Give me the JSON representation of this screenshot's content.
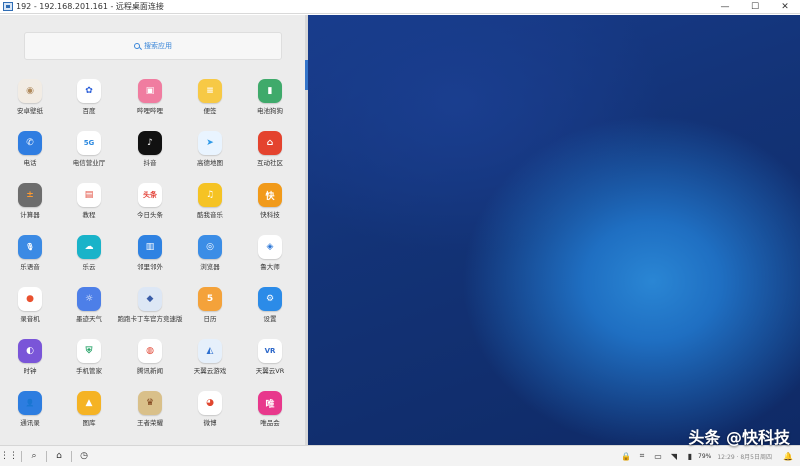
{
  "window": {
    "title": "192 - 192.168.201.161 - 远程桌面连接",
    "minimize": "—",
    "maximize": "☐",
    "close": "✕"
  },
  "search": {
    "placeholder": "搜索应用"
  },
  "apps": [
    {
      "label": "安卓壁纸",
      "glyph": "◉",
      "bg": "#f2ece4",
      "fg": "#b08a5c"
    },
    {
      "label": "百度",
      "glyph": "✿",
      "bg": "#ffffff",
      "fg": "#2b5fd9"
    },
    {
      "label": "哔哩哔哩",
      "glyph": "▣",
      "bg": "#f07ca0",
      "fg": "#ffffff"
    },
    {
      "label": "便签",
      "glyph": "≡",
      "bg": "#f7c945",
      "fg": "#ffffff"
    },
    {
      "label": "电池狗狗",
      "glyph": "▮",
      "bg": "#3faa6b",
      "fg": "#ffffff"
    },
    {
      "label": "电话",
      "glyph": "✆",
      "bg": "#2f7de1",
      "fg": "#ffffff"
    },
    {
      "label": "电信营业厅",
      "glyph": "5G",
      "bg": "#ffffff",
      "fg": "#2d8ae0"
    },
    {
      "label": "抖音",
      "glyph": "♪",
      "bg": "#111111",
      "fg": "#ffffff"
    },
    {
      "label": "高德地图",
      "glyph": "➤",
      "bg": "#e9f4ff",
      "fg": "#2f9ae8"
    },
    {
      "label": "互动社区",
      "glyph": "⌂",
      "bg": "#e4432e",
      "fg": "#ffffff"
    },
    {
      "label": "计算器",
      "glyph": "±",
      "bg": "#6d6d6d",
      "fg": "#ff9a2e"
    },
    {
      "label": "教程",
      "glyph": "▤",
      "bg": "#ffffff",
      "fg": "#e24a3b"
    },
    {
      "label": "今日头条",
      "glyph": "头条",
      "bg": "#ffffff",
      "fg": "#e23c32"
    },
    {
      "label": "酷我音乐",
      "glyph": "♫",
      "bg": "#f5c324",
      "fg": "#ffffff"
    },
    {
      "label": "快科技",
      "glyph": "快",
      "bg": "#f19a1a",
      "fg": "#ffffff"
    },
    {
      "label": "乐语音",
      "glyph": "🎙",
      "bg": "#3b8ae4",
      "fg": "#ffffff"
    },
    {
      "label": "乐云",
      "glyph": "☁",
      "bg": "#19b3c9",
      "fg": "#ffffff"
    },
    {
      "label": "邻里邻外",
      "glyph": "▥",
      "bg": "#2f82e2",
      "fg": "#ffffff"
    },
    {
      "label": "浏览器",
      "glyph": "◎",
      "bg": "#3b8de6",
      "fg": "#ffffff"
    },
    {
      "label": "鲁大师",
      "glyph": "◈",
      "bg": "#ffffff",
      "fg": "#2874d6"
    },
    {
      "label": "录音机",
      "glyph": "●",
      "bg": "#ffffff",
      "fg": "#e9512f"
    },
    {
      "label": "墨迹天气",
      "glyph": "☼",
      "bg": "#4d7fe8",
      "fg": "#ffffff"
    },
    {
      "label": "跑跑卡丁车官方竞速版",
      "glyph": "◆",
      "bg": "#dde7f5",
      "fg": "#3a5da8"
    },
    {
      "label": "日历",
      "glyph": "5",
      "bg": "#f4a23a",
      "fg": "#ffffff"
    },
    {
      "label": "设置",
      "glyph": "⚙",
      "bg": "#2b8be8",
      "fg": "#ffffff"
    },
    {
      "label": "时钟",
      "glyph": "◐",
      "bg": "#7a55d8",
      "fg": "#ffffff"
    },
    {
      "label": "手机管家",
      "glyph": "⛨",
      "bg": "#ffffff",
      "fg": "#2aa56b"
    },
    {
      "label": "腾讯新闻",
      "glyph": "◍",
      "bg": "#ffffff",
      "fg": "#e0412f"
    },
    {
      "label": "天翼云游戏",
      "glyph": "◭",
      "bg": "#e6f0fb",
      "fg": "#2c6fd0"
    },
    {
      "label": "天翼云VR",
      "glyph": "VR",
      "bg": "#ffffff",
      "fg": "#2a66c9"
    },
    {
      "label": "通讯录",
      "glyph": "👤",
      "bg": "#2d7de0",
      "fg": "#ffffff"
    },
    {
      "label": "图库",
      "glyph": "▲",
      "bg": "#f5b324",
      "fg": "#ffffff"
    },
    {
      "label": "王者荣耀",
      "glyph": "♛",
      "bg": "#d9c08a",
      "fg": "#7a3b14"
    },
    {
      "label": "微博",
      "glyph": "◕",
      "bg": "#ffffff",
      "fg": "#e0462f"
    },
    {
      "label": "唯品会",
      "glyph": "唯",
      "bg": "#e8388c",
      "fg": "#ffffff"
    }
  ],
  "taskbar": {
    "apps": "⋮⋮",
    "search": "⌕",
    "home": "⌂",
    "history": "◷"
  },
  "tray": {
    "lock": "🔒",
    "crop": "⌗",
    "screen": "▭",
    "wifi": "◥",
    "battery_icon": "▮",
    "battery": "79%",
    "time": "12:29 · 8月5日周四",
    "notify": "🔔"
  },
  "watermark": "头条 @快科技"
}
